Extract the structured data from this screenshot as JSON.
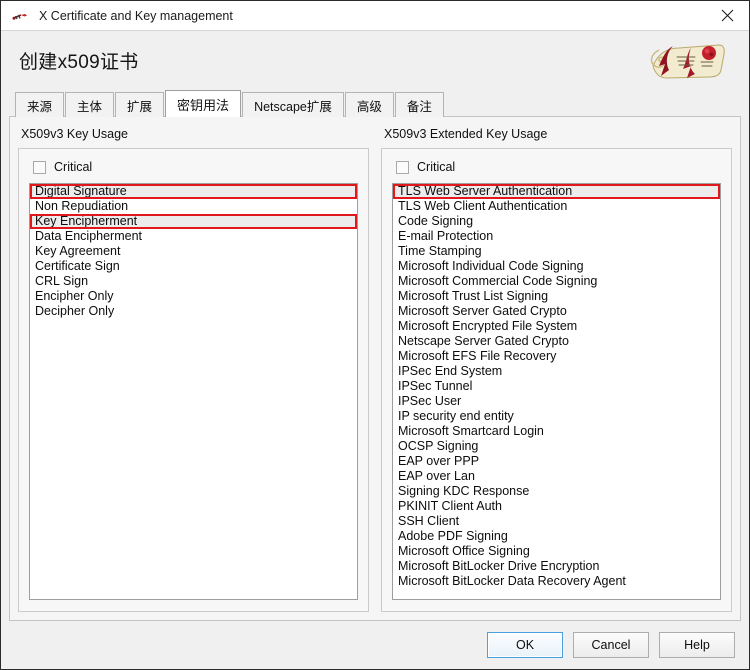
{
  "window": {
    "title": "X Certificate and Key management",
    "app_icon": "key-icon",
    "close_icon": "close-icon"
  },
  "header": {
    "page_title": "创建x509证书",
    "logo_icon": "certificate-scroll-logo"
  },
  "tabs": [
    {
      "label": "来源",
      "active": false
    },
    {
      "label": "主体",
      "active": false
    },
    {
      "label": "扩展",
      "active": false
    },
    {
      "label": "密钥用法",
      "active": true
    },
    {
      "label": "Netscape扩展",
      "active": false
    },
    {
      "label": "高级",
      "active": false
    },
    {
      "label": "备注",
      "active": false
    }
  ],
  "key_usage": {
    "group_label": "X509v3 Key Usage",
    "critical_label": "Critical",
    "critical_checked": false,
    "items": [
      {
        "label": "Digital Signature",
        "selected": true,
        "annotated": true
      },
      {
        "label": "Non Repudiation",
        "selected": false,
        "annotated": false
      },
      {
        "label": "Key Encipherment",
        "selected": true,
        "annotated": true
      },
      {
        "label": "Data Encipherment",
        "selected": false,
        "annotated": false
      },
      {
        "label": "Key Agreement",
        "selected": false,
        "annotated": false
      },
      {
        "label": "Certificate Sign",
        "selected": false,
        "annotated": false
      },
      {
        "label": "CRL Sign",
        "selected": false,
        "annotated": false
      },
      {
        "label": "Encipher Only",
        "selected": false,
        "annotated": false
      },
      {
        "label": "Decipher Only",
        "selected": false,
        "annotated": false
      }
    ]
  },
  "extended_key_usage": {
    "group_label": "X509v3 Extended Key Usage",
    "critical_label": "Critical",
    "critical_checked": false,
    "items": [
      {
        "label": "TLS Web Server Authentication",
        "selected": true,
        "annotated": true
      },
      {
        "label": "TLS Web Client Authentication",
        "selected": false,
        "annotated": false
      },
      {
        "label": "Code Signing",
        "selected": false,
        "annotated": false
      },
      {
        "label": "E-mail Protection",
        "selected": false,
        "annotated": false
      },
      {
        "label": "Time Stamping",
        "selected": false,
        "annotated": false
      },
      {
        "label": "Microsoft Individual Code Signing",
        "selected": false,
        "annotated": false
      },
      {
        "label": "Microsoft Commercial Code Signing",
        "selected": false,
        "annotated": false
      },
      {
        "label": "Microsoft Trust List Signing",
        "selected": false,
        "annotated": false
      },
      {
        "label": "Microsoft Server Gated Crypto",
        "selected": false,
        "annotated": false
      },
      {
        "label": "Microsoft Encrypted File System",
        "selected": false,
        "annotated": false
      },
      {
        "label": "Netscape Server Gated Crypto",
        "selected": false,
        "annotated": false
      },
      {
        "label": "Microsoft EFS File Recovery",
        "selected": false,
        "annotated": false
      },
      {
        "label": "IPSec End System",
        "selected": false,
        "annotated": false
      },
      {
        "label": "IPSec Tunnel",
        "selected": false,
        "annotated": false
      },
      {
        "label": "IPSec User",
        "selected": false,
        "annotated": false
      },
      {
        "label": "IP security end entity",
        "selected": false,
        "annotated": false
      },
      {
        "label": "Microsoft Smartcard Login",
        "selected": false,
        "annotated": false
      },
      {
        "label": "OCSP Signing",
        "selected": false,
        "annotated": false
      },
      {
        "label": "EAP over PPP",
        "selected": false,
        "annotated": false
      },
      {
        "label": "EAP over Lan",
        "selected": false,
        "annotated": false
      },
      {
        "label": "Signing KDC Response",
        "selected": false,
        "annotated": false
      },
      {
        "label": "PKINIT Client Auth",
        "selected": false,
        "annotated": false
      },
      {
        "label": "SSH Client",
        "selected": false,
        "annotated": false
      },
      {
        "label": "Adobe PDF Signing",
        "selected": false,
        "annotated": false
      },
      {
        "label": "Microsoft Office Signing",
        "selected": false,
        "annotated": false
      },
      {
        "label": "Microsoft BitLocker Drive Encryption",
        "selected": false,
        "annotated": false
      },
      {
        "label": "Microsoft BitLocker Data Recovery Agent",
        "selected": false,
        "annotated": false
      }
    ]
  },
  "buttons": {
    "ok": "OK",
    "cancel": "Cancel",
    "help": "Help"
  },
  "colors": {
    "annotation_red": "#e0171b",
    "selection_gray": "#ececec",
    "default_button_focus": "#4a9fe0"
  }
}
